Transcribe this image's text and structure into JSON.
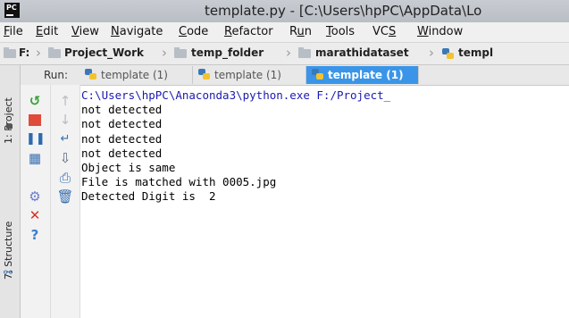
{
  "window": {
    "title": "template.py - [C:\\Users\\hpPC\\AppData\\Lo"
  },
  "menu": [
    {
      "pre": "",
      "u": "F",
      "post": "ile"
    },
    {
      "pre": "",
      "u": "E",
      "post": "dit"
    },
    {
      "pre": "",
      "u": "V",
      "post": "iew"
    },
    {
      "pre": "",
      "u": "N",
      "post": "avigate"
    },
    {
      "pre": "",
      "u": "C",
      "post": "ode"
    },
    {
      "pre": "",
      "u": "R",
      "post": "efactor"
    },
    {
      "pre": "R",
      "u": "u",
      "post": "n"
    },
    {
      "pre": "",
      "u": "T",
      "post": "ools"
    },
    {
      "pre": "VC",
      "u": "S",
      "post": ""
    },
    {
      "pre": "",
      "u": "W",
      "post": "indow"
    }
  ],
  "breadcrumb": [
    "F:",
    "Project_Work",
    "temp_folder",
    "marathidataset",
    "templ"
  ],
  "sidebar": {
    "project_tab": "1: Project",
    "structure_tab": "7: Structure"
  },
  "run": {
    "label": "Run:",
    "tabs": [
      "template (1)",
      "template (1)",
      "template (1)"
    ]
  },
  "console": {
    "lines": [
      "C:\\Users\\hpPC\\Anaconda3\\python.exe F:/Project_",
      "not detected",
      "not detected",
      "not detected",
      "not detected",
      "Object is same",
      "File is matched with 0005.jpg",
      "Detected Digit is  2"
    ]
  },
  "colors": {
    "active_tab": "#3a95e8",
    "path_text": "#1a1ab0",
    "rerun": "#3aa03a",
    "stop": "#e04a3a"
  }
}
